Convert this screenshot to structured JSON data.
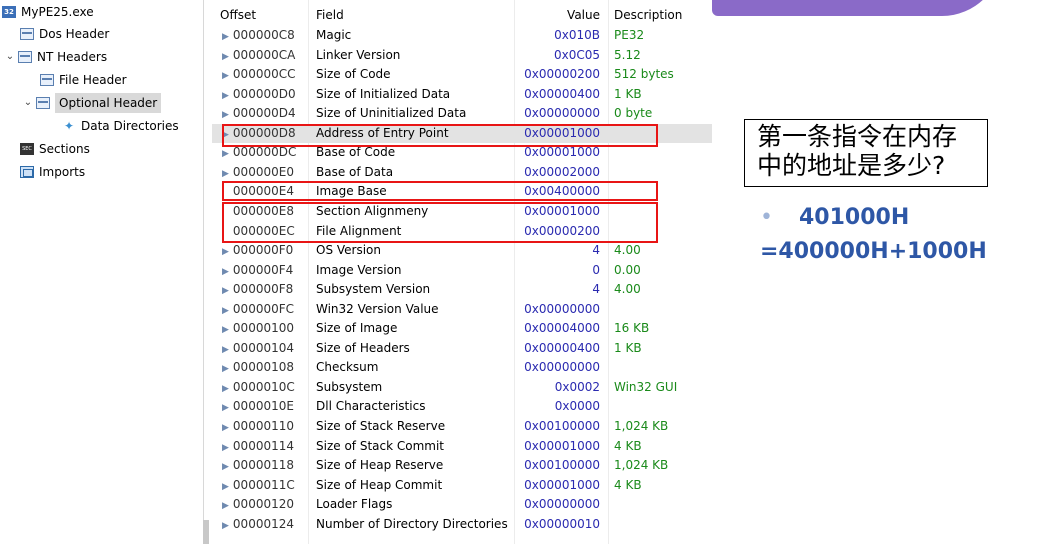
{
  "tree": {
    "items": [
      {
        "label": "MyPE25.exe",
        "icon": "exe-icon",
        "level": 0,
        "chevron": ""
      },
      {
        "label": "Dos Header",
        "icon": "header-icon",
        "level": 1,
        "chevron": ""
      },
      {
        "label": "NT Headers",
        "icon": "header-icon",
        "level": 1,
        "chevron": "expanded"
      },
      {
        "label": "File Header",
        "icon": "header-icon",
        "level": 2,
        "chevron": ""
      },
      {
        "label": "Optional Header",
        "icon": "header-icon",
        "level": 2,
        "chevron": "expanded",
        "selected": true
      },
      {
        "label": "Data Directories",
        "icon": "data-directories-icon",
        "level": 3,
        "chevron": ""
      },
      {
        "label": "Sections",
        "icon": "sections-icon",
        "level": 1,
        "chevron": ""
      },
      {
        "label": "Imports",
        "icon": "imports-icon",
        "level": 1,
        "chevron": ""
      }
    ]
  },
  "table": {
    "columns": {
      "offset": "Offset",
      "field": "Field",
      "value": "Value",
      "description": "Description"
    },
    "rows": [
      {
        "offset": "000000C8",
        "field": "Magic",
        "value": "0x010B",
        "description": "PE32",
        "arrow": true
      },
      {
        "offset": "000000CA",
        "field": "Linker Version",
        "value": "0x0C05",
        "description": "5.12",
        "arrow": true
      },
      {
        "offset": "000000CC",
        "field": "Size of Code",
        "value": "0x00000200",
        "description": "512 bytes",
        "arrow": true
      },
      {
        "offset": "000000D0",
        "field": "Size of Initialized Data",
        "value": "0x00000400",
        "description": "1 KB",
        "arrow": true
      },
      {
        "offset": "000000D4",
        "field": "Size of Uninitialized Data",
        "value": "0x00000000",
        "description": "0 byte",
        "arrow": true
      },
      {
        "offset": "000000D8",
        "field": "Address of Entry Point",
        "value": "0x00001000",
        "description": "",
        "arrow": true,
        "highlight": true
      },
      {
        "offset": "000000DC",
        "field": "Base of Code",
        "value": "0x00001000",
        "description": "",
        "arrow": true
      },
      {
        "offset": "000000E0",
        "field": "Base of Data",
        "value": "0x00002000",
        "description": "",
        "arrow": true
      },
      {
        "offset": "000000E4",
        "field": "Image Base",
        "value": "0x00400000",
        "description": "",
        "arrow": false
      },
      {
        "offset": "000000E8",
        "field": "Section Alignmeny",
        "value": "0x00001000",
        "description": "",
        "arrow": false
      },
      {
        "offset": "000000EC",
        "field": "File Alignment",
        "value": "0x00000200",
        "description": "",
        "arrow": false
      },
      {
        "offset": "000000F0",
        "field": "OS Version",
        "value": "4",
        "description": "4.00",
        "arrow": true
      },
      {
        "offset": "000000F4",
        "field": "Image Version",
        "value": "0",
        "description": "0.00",
        "arrow": true
      },
      {
        "offset": "000000F8",
        "field": "Subsystem Version",
        "value": "4",
        "description": "4.00",
        "arrow": true
      },
      {
        "offset": "000000FC",
        "field": "Win32 Version Value",
        "value": "0x00000000",
        "description": "",
        "arrow": true
      },
      {
        "offset": "00000100",
        "field": "Size of Image",
        "value": "0x00004000",
        "description": "16 KB",
        "arrow": true
      },
      {
        "offset": "00000104",
        "field": "Size of Headers",
        "value": "0x00000400",
        "description": "1 KB",
        "arrow": true
      },
      {
        "offset": "00000108",
        "field": "Checksum",
        "value": "0x00000000",
        "description": "",
        "arrow": true
      },
      {
        "offset": "0000010C",
        "field": "Subsystem",
        "value": "0x0002",
        "description": "Win32 GUI",
        "arrow": true
      },
      {
        "offset": "0000010E",
        "field": "Dll Characteristics",
        "value": "0x0000",
        "description": "",
        "arrow": true
      },
      {
        "offset": "00000110",
        "field": "Size of Stack Reserve",
        "value": "0x00100000",
        "description": "1,024 KB",
        "arrow": true
      },
      {
        "offset": "00000114",
        "field": "Size of Stack Commit",
        "value": "0x00001000",
        "description": "4 KB",
        "arrow": true
      },
      {
        "offset": "00000118",
        "field": "Size of Heap Reserve",
        "value": "0x00100000",
        "description": "1,024 KB",
        "arrow": true
      },
      {
        "offset": "0000011C",
        "field": "Size of Heap Commit",
        "value": "0x00001000",
        "description": "4 KB",
        "arrow": true
      },
      {
        "offset": "00000120",
        "field": "Loader Flags",
        "value": "0x00000000",
        "description": "",
        "arrow": true
      },
      {
        "offset": "00000124",
        "field": "Number of Directory Directories",
        "value": "0x00000010",
        "description": "",
        "arrow": true
      }
    ]
  },
  "slide": {
    "question": "第一条指令在内存中的地址是多少?",
    "answer_bullet": "•",
    "answer": "401000H",
    "calculation": "=400000H+1000H"
  },
  "colors": {
    "value_blue": "#2a2ab0",
    "description_green": "#1a8a1a",
    "annotation_red": "#e81515",
    "answer_blue": "#2e57a6",
    "deco_purple": "#8a6ac8"
  }
}
